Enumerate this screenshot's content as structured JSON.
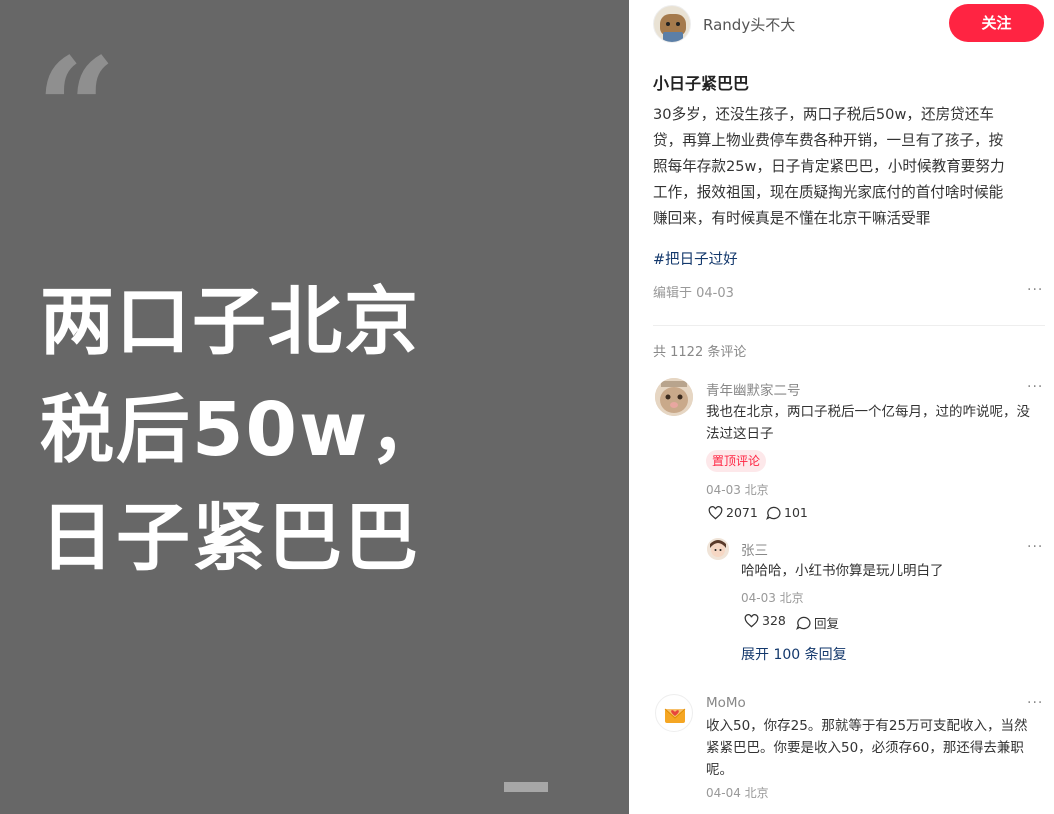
{
  "cover": {
    "quote_mark": "“",
    "lines": [
      "两口子北京",
      "税后50w，",
      "日子紧巴巴"
    ]
  },
  "author": {
    "name": "Randy头不大",
    "follow_label": "关注"
  },
  "note": {
    "title": "小日子紧巴巴",
    "body_lines": [
      "30多岁，还没生孩子，两口子税后50w，还房贷还车",
      "贷，再算上物业费停车费各种开销，一旦有了孩子，按",
      "照每年存款25w，日子肯定紧巴巴，小时候教育要努力",
      "工作，报效祖国，现在质疑掏光家底付的首付啥时候能",
      "赚回来，有时候真是不懂在北京干嘛活受罪"
    ],
    "tag": "#把日子过好",
    "edited": "编辑于 04-03",
    "more": "···"
  },
  "comments_total": "共 1122 条评论",
  "comments": [
    {
      "name": "青年幽默家二号",
      "lines": [
        "我也在北京，两口子税后一个亿每月，过的咋说呢，没",
        "法过这日子"
      ],
      "pin": "置顶评论",
      "meta": "04-03 北京",
      "likes": "2071",
      "replies": "101",
      "more": "···"
    },
    {
      "name": "MoMo",
      "lines": [
        "收入50，你存25。那就等于有25万可支配收入，当然",
        "紧紧巴巴。你要是收入50，必须存60，那还得去兼职",
        "呢。"
      ],
      "meta": "04-04 北京",
      "more": "···"
    }
  ],
  "reply": {
    "name": "张三",
    "text": "哈哈哈，小红书你算是玩儿明白了",
    "meta": "04-03 北京",
    "likes": "328",
    "reply_label": "回复",
    "more": "···"
  },
  "expand_label": "展开 100 条回复",
  "colors": {
    "accent": "#ff2442",
    "link": "#13386c",
    "cover_bg": "#676767"
  }
}
